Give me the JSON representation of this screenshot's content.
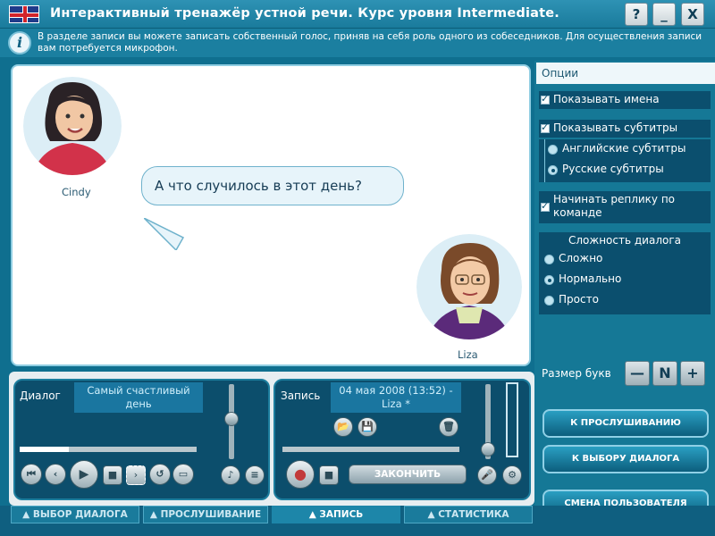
{
  "window": {
    "title": "Интерактивный тренажёр устной речи. Курс уровня Intermediate.",
    "buttons": {
      "help": "?",
      "minimize": "_",
      "close": "X"
    }
  },
  "info": {
    "text": "В разделе записи вы можете записать собственный голос, приняв на себя роль одного из собеседников. Для осуществления записи вам потребуется микрофон."
  },
  "stage": {
    "speaker1": "Cindy",
    "speaker2": "Liza",
    "bubble": "А что случилось в этот день?"
  },
  "options": {
    "title": "Опции",
    "show_names": "Показывать имена",
    "show_subtitles": "Показывать субтитры",
    "english_subtitles": "Английские субтитры",
    "russian_subtitles": "Русские субтитры",
    "start_on_command": "Начинать реплику по команде",
    "difficulty_title": "Сложность диалога",
    "difficulty_hard": "Сложно",
    "difficulty_normal": "Нормально",
    "difficulty_easy": "Просто",
    "font_size_label": "Размер букв",
    "font_minus": "—",
    "font_normal": "N",
    "font_plus": "+",
    "btn_listen": "К ПРОСЛУШИВАНИЮ",
    "btn_dialog": "К ВЫБОРУ ДИАЛОГА",
    "btn_user": "СМЕНА ПОЛЬЗОВАТЕЛЯ"
  },
  "dialog_panel": {
    "label": "Диалог",
    "name": "Самый счастливый день",
    "progress": 0.28,
    "volume": 0.55
  },
  "record_panel": {
    "label": "Запись",
    "name": "04 мая 2008 (13:52) - Liza *",
    "finish": "ЗАКОНЧИТЬ",
    "volume": 0.05
  },
  "tabs": {
    "select_dialog": "ВЫБОР ДИАЛОГА",
    "listening": "ПРОСЛУШИВАНИЕ",
    "record": "ЗАПИСЬ",
    "stats": "СТАТИСТИКА"
  }
}
